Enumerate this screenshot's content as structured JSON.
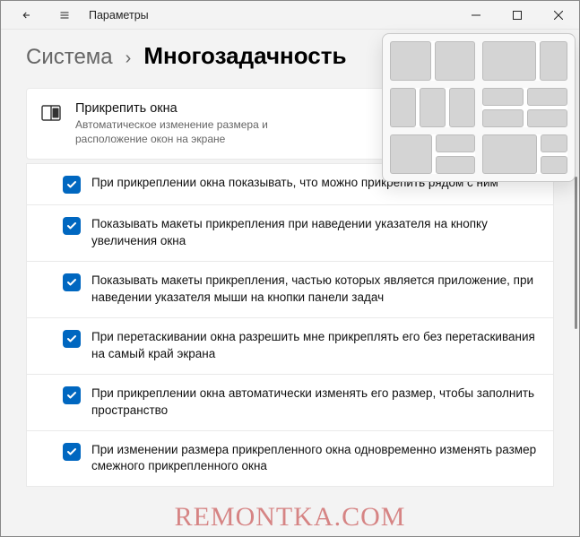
{
  "window": {
    "title": "Параметры"
  },
  "breadcrumb": {
    "parent": "Система",
    "sep": "›",
    "current": "Многозадачность"
  },
  "section": {
    "title": "Прикрепить окна",
    "desc": "Автоматическое изменение размера и расположение окон на экране"
  },
  "options": [
    {
      "checked": true,
      "label": "При прикреплении окна показывать, что можно прикрепить рядом с ним"
    },
    {
      "checked": true,
      "label": "Показывать макеты прикрепления при наведении указателя на кнопку увеличения окна"
    },
    {
      "checked": true,
      "label": "Показывать макеты прикрепления, частью которых является приложение, при наведении указателя мыши на кнопки панели задач"
    },
    {
      "checked": true,
      "label": "При перетаскивании окна разрешить мне прикреплять его без перетаскивания на самый край экрана"
    },
    {
      "checked": true,
      "label": "При прикреплении окна автоматически изменять его размер, чтобы заполнить пространство"
    },
    {
      "checked": true,
      "label": "При изменении размера прикрепленного окна одновременно изменять размер смежного прикрепленного окна"
    }
  ],
  "watermark": "REMONTKA.COM"
}
